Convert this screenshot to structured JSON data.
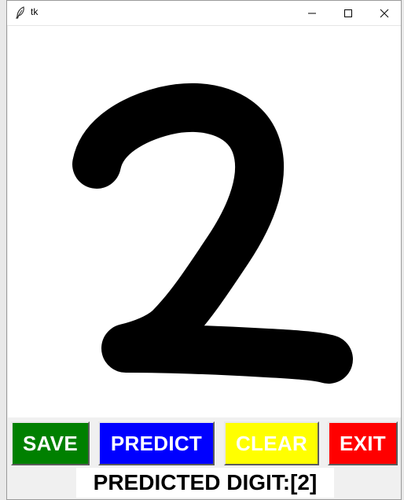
{
  "window": {
    "title": "tk",
    "controls": {
      "minimize_icon": "minimize-icon",
      "maximize_icon": "maximize-icon",
      "close_icon": "close-icon"
    }
  },
  "canvas": {
    "drawn_digit": "2",
    "stroke_color": "#000000",
    "background": "#ffffff"
  },
  "buttons": {
    "save": {
      "label": "SAVE",
      "bg": "#008000",
      "fg": "#ffffff"
    },
    "predict": {
      "label": "PREDICT",
      "bg": "#0000ff",
      "fg": "#ffffff"
    },
    "clear": {
      "label": "CLEAR",
      "bg": "#ffff00",
      "fg": "#ffffff"
    },
    "exit": {
      "label": "EXIT",
      "bg": "#ff0000",
      "fg": "#ffffff"
    }
  },
  "result": {
    "text": "PREDICTED DIGIT:[2]"
  }
}
